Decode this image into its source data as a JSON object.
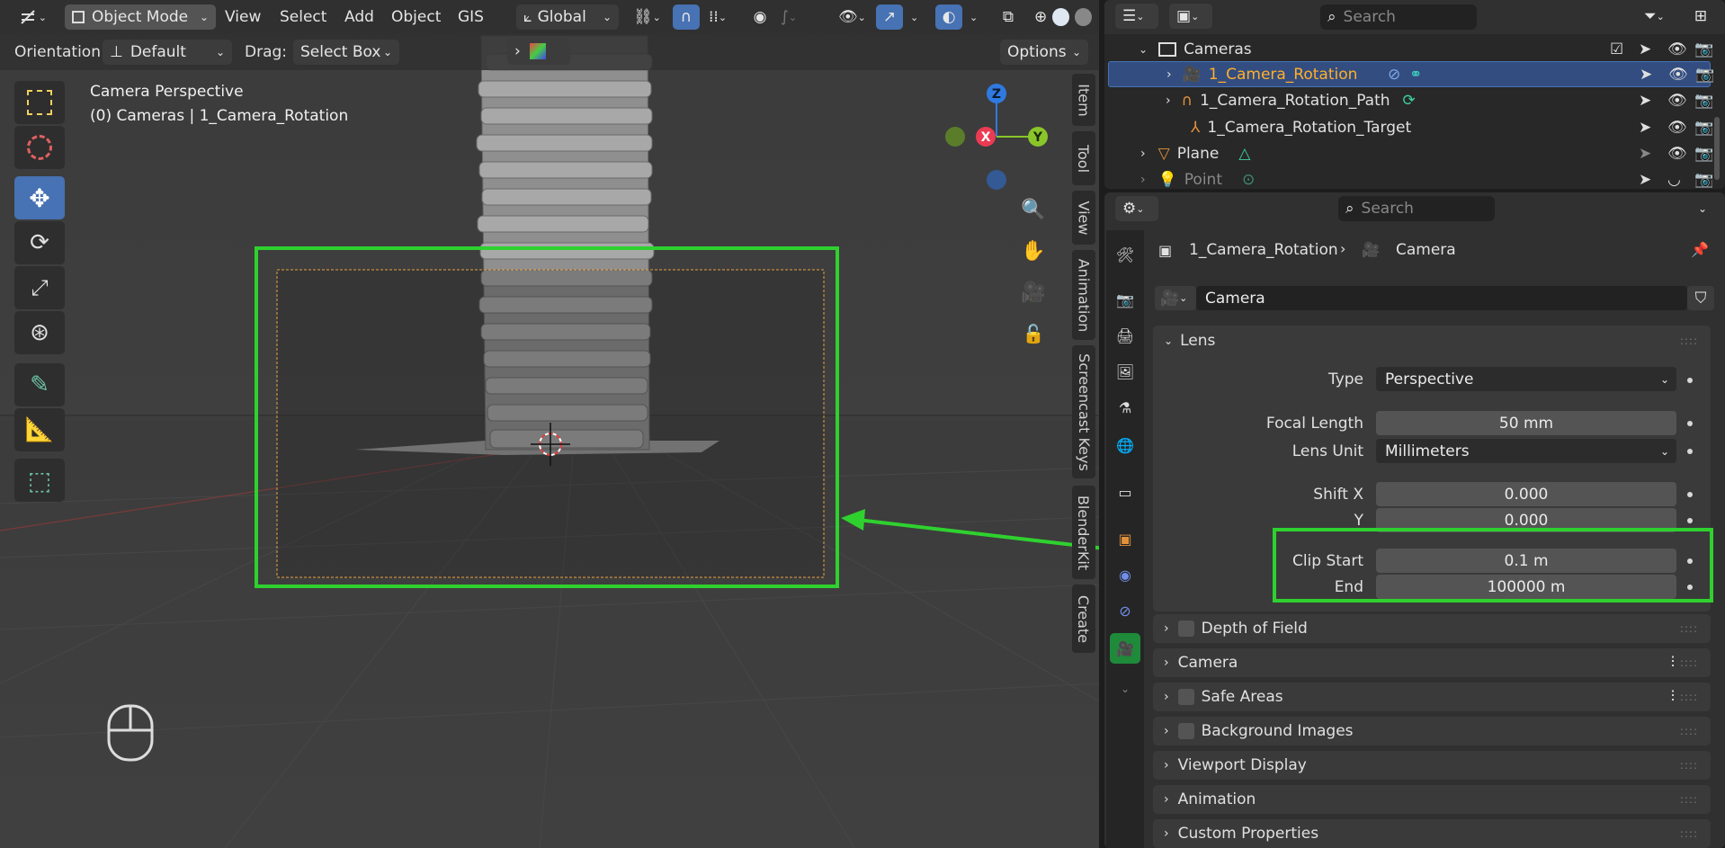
{
  "header": {
    "editor_icon": "3d-viewport-icon",
    "mode": "Object Mode",
    "menus": [
      "View",
      "Select",
      "Add",
      "Object",
      "GIS"
    ],
    "transform_orientation": "Global"
  },
  "header2": {
    "orientation_label": "Orientation:",
    "orientation_value": "Default",
    "drag_label": "Drag:",
    "drag_value": "Select Box",
    "options": "Options"
  },
  "viewport": {
    "perspective": "Camera Perspective",
    "collection": "(0) Cameras | 1_Camera_Rotation",
    "gizmo": {
      "z": "Z",
      "x": "X",
      "y": "Y"
    },
    "side_tabs": [
      "Item",
      "Tool",
      "View",
      "Animation",
      "Screencast Keys",
      "BlenderKit",
      "Create"
    ]
  },
  "outliner": {
    "search_placeholder": "Search",
    "rows": [
      {
        "label": "Cameras",
        "type": "collection"
      },
      {
        "label": "1_Camera_Rotation",
        "type": "camera",
        "selected": true
      },
      {
        "label": "1_Camera_Rotation_Path",
        "type": "curve"
      },
      {
        "label": "1_Camera_Rotation_Target",
        "type": "empty"
      },
      {
        "label": "Plane",
        "type": "mesh"
      },
      {
        "label": "Point",
        "type": "light"
      }
    ]
  },
  "properties": {
    "search_placeholder": "Search",
    "breadcrumb_object": "1_Camera_Rotation",
    "breadcrumb_data": "Camera",
    "datablock_name": "Camera",
    "lens_panel": "Lens",
    "type_label": "Type",
    "type_value": "Perspective",
    "focal_label": "Focal Length",
    "focal_value": "50 mm",
    "lens_unit_label": "Lens Unit",
    "lens_unit_value": "Millimeters",
    "shift_x_label": "Shift X",
    "shift_x_value": "0.000",
    "shift_y_label": "Y",
    "shift_y_value": "0.000",
    "clip_start_label": "Clip Start",
    "clip_start_value": "0.1 m",
    "clip_end_label": "End",
    "clip_end_value": "100000 m",
    "panels": [
      "Depth of Field",
      "Camera",
      "Safe Areas",
      "Background Images",
      "Viewport Display",
      "Animation",
      "Custom Properties"
    ]
  },
  "colors": {
    "highlight": "#2fd12f",
    "selection": "#4772b3",
    "active_orange": "#ffaf29",
    "camera_frame": "#e8a040"
  }
}
